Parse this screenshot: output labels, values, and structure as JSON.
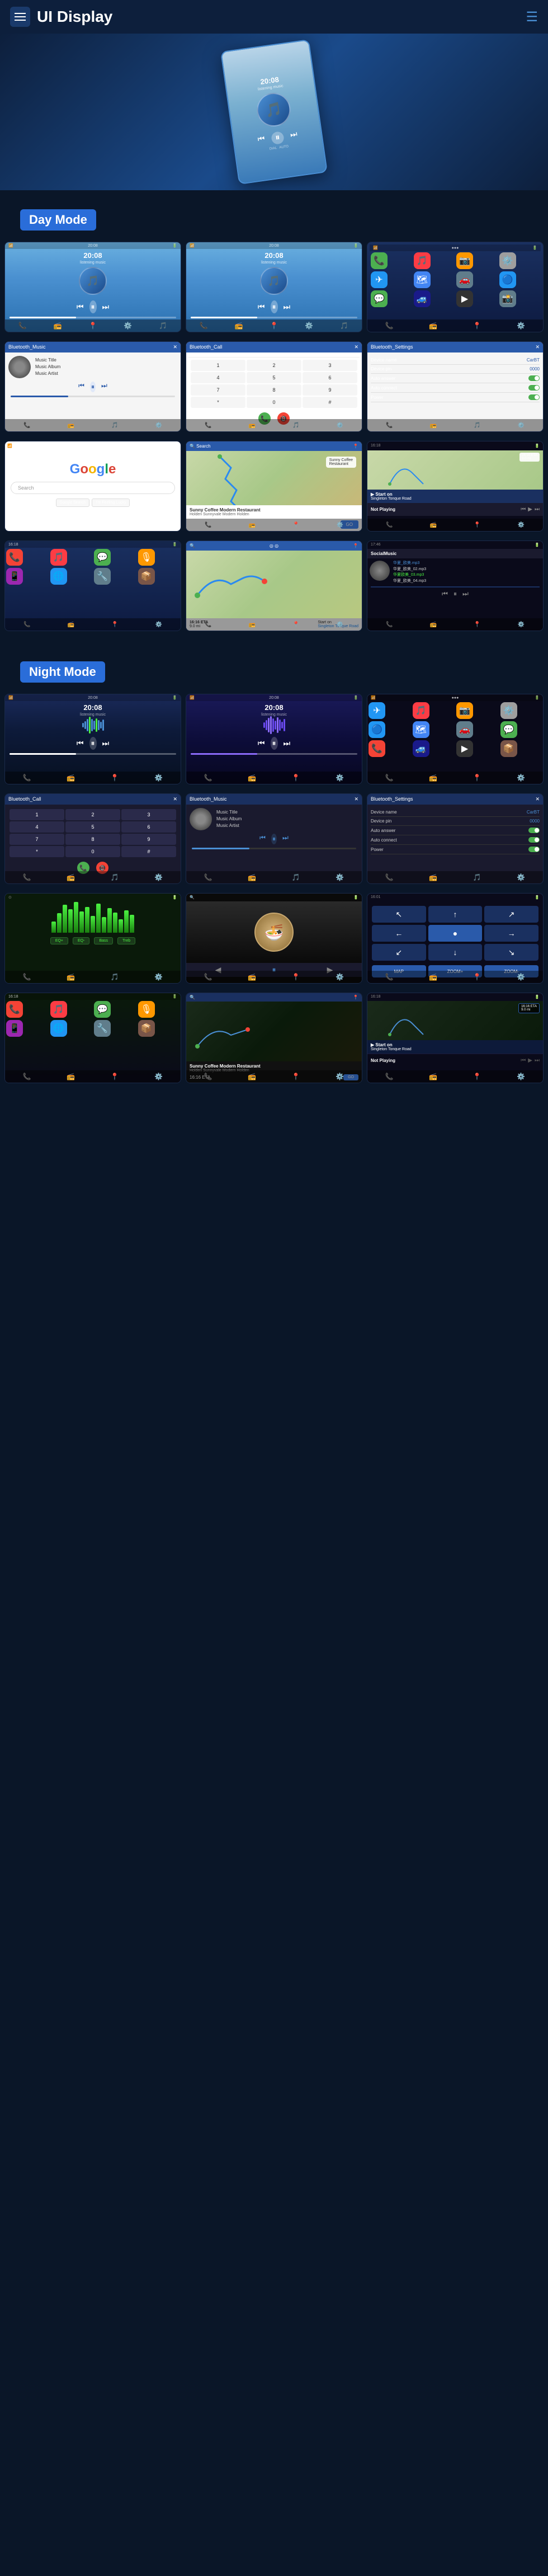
{
  "header": {
    "title": "UI Display",
    "menu_icon": "≡"
  },
  "day_mode": {
    "label": "Day Mode"
  },
  "night_mode": {
    "label": "Night Mode"
  },
  "music": {
    "time": "20:08",
    "title": "Music Title",
    "album": "Music Album",
    "artist": "Music Artist"
  },
  "bluetooth": {
    "call_title": "Bluetooth_Call",
    "music_title": "Bluetooth_Music",
    "settings_title": "Bluetooth_Settings",
    "device_name_label": "Device name",
    "device_name_value": "CarBT",
    "device_pin_label": "Device pin",
    "device_pin_value": "0000",
    "auto_answer_label": "Auto answer",
    "auto_connect_label": "Auto connect",
    "power_label": "Power"
  },
  "nav": {
    "eta": "16:16 ETA",
    "distance": "9.0 mi",
    "coffee_shop": "Sunny Coffee Modern Restaurant",
    "coffee_addr": "Holden Sunnyvale Modern Holden",
    "go_label": "GO",
    "not_playing": "Not Playing",
    "start_on": "Start on",
    "street": "Singleton Tonque Road"
  },
  "wave_heights": [
    8,
    14,
    20,
    26,
    32,
    22,
    28,
    18,
    24,
    30,
    20,
    14,
    26,
    22,
    16,
    28,
    34,
    24,
    18,
    22
  ],
  "eq_heights": [
    20,
    35,
    45,
    55,
    48,
    40,
    52,
    38,
    44,
    30,
    46,
    50,
    42,
    36,
    28,
    40,
    52,
    44,
    32,
    24
  ],
  "app_colors": {
    "phone": "#4CAF50",
    "messages": "#4CAF50",
    "music": "#fc3c44",
    "maps": "#4285F4",
    "telegram": "#2196F3",
    "bt": "#2196F3",
    "settings": "#9E9E9E",
    "camera": "#607D8B",
    "photos": "#FF9800",
    "carplay": "#000"
  }
}
